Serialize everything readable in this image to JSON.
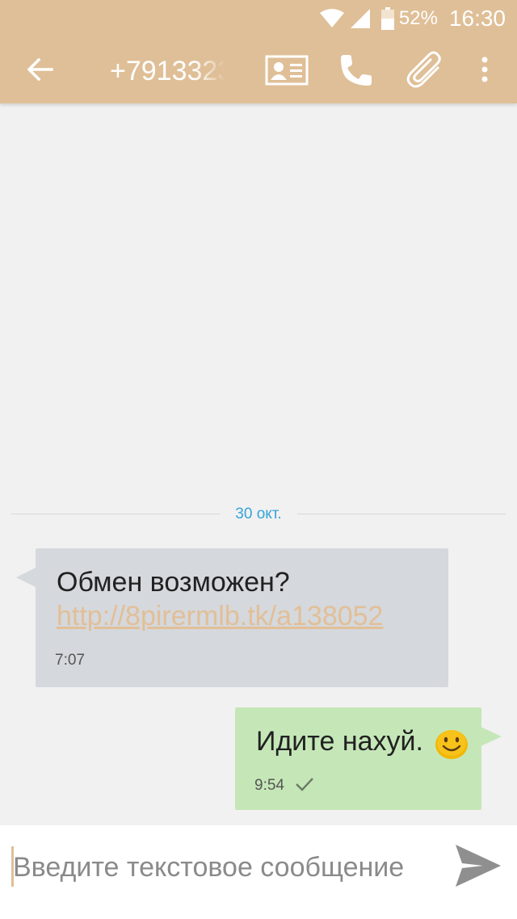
{
  "status_bar": {
    "battery_percent": "52%",
    "time": "16:30",
    "icons": [
      "wifi-icon",
      "signal-icon",
      "battery-icon"
    ]
  },
  "toolbar": {
    "title": "+7913323",
    "icons": [
      "back-arrow-icon",
      "contact-card-icon",
      "phone-icon",
      "paperclip-icon",
      "more-vertical-icon"
    ]
  },
  "thread": {
    "date_divider": "30 окт.",
    "messages": [
      {
        "direction": "incoming",
        "text": "Обмен возможен?",
        "link": "http://8pirermlb.tk/a138052",
        "time": "7:07"
      },
      {
        "direction": "outgoing",
        "text": "Идите нахуй.",
        "emoji": "smiling-face-emoji",
        "time": "9:54",
        "status_icon": "check-icon"
      }
    ]
  },
  "composer": {
    "placeholder": "Введите текстовое сообщение",
    "value": "",
    "send_icon": "send-icon"
  },
  "colors": {
    "toolbar": "#dfbf97",
    "background": "#f1f1f1",
    "incoming_bubble": "#d5d8dc",
    "outgoing_bubble": "#c5e7b8",
    "link": "#e2bf97",
    "date_label": "#35a4d8"
  }
}
